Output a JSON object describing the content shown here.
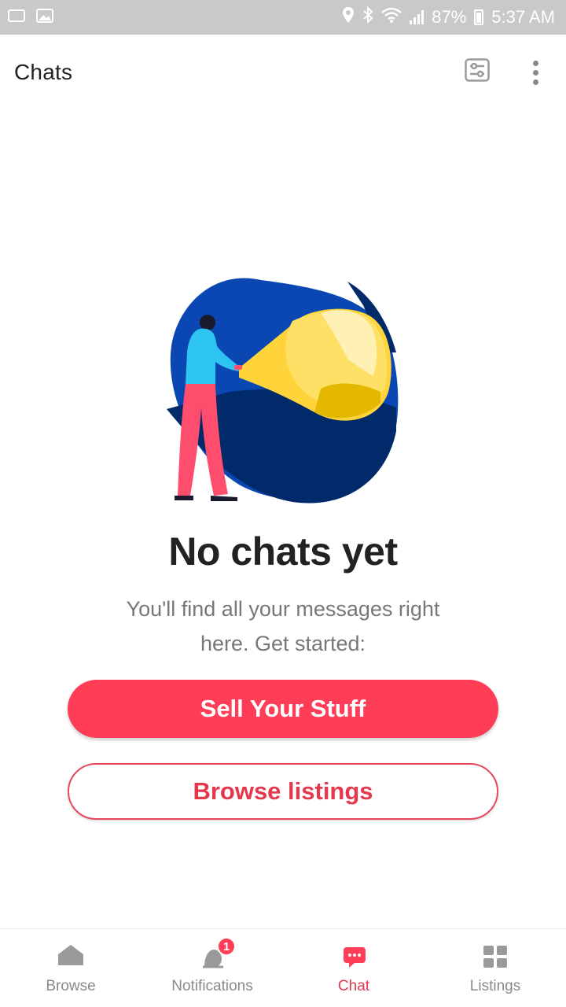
{
  "status_bar": {
    "battery": "87%",
    "time": "5:37 AM",
    "icons": [
      "notification-icon",
      "image-icon",
      "location-icon",
      "bluetooth-icon",
      "wifi-icon",
      "signal-icon",
      "battery-icon"
    ]
  },
  "header": {
    "title": "Chats",
    "actions": [
      "filter-icon",
      "more-vert-icon"
    ]
  },
  "empty_state": {
    "illustration": "person-with-flashlight-illustration",
    "title": "No chats yet",
    "subtitle": "You'll find all your messages right here. Get started:",
    "primary_button": "Sell Your Stuff",
    "secondary_button": "Browse listings"
  },
  "bottom_nav": {
    "items": [
      {
        "label": "Browse",
        "icon": "home-icon",
        "active": false
      },
      {
        "label": "Notifications",
        "icon": "notifications-icon",
        "active": false,
        "badge": "1"
      },
      {
        "label": "Chat",
        "icon": "chat-icon",
        "active": true
      },
      {
        "label": "Listings",
        "icon": "listings-icon",
        "active": false
      }
    ]
  },
  "colors": {
    "accent": "#ff3d57",
    "accent_text": "#e5384f",
    "status_bar": "#c9c9c9",
    "illustration_blue": "#0b47b3",
    "illustration_navy": "#012a6b",
    "illustration_yellow": "#ffd43b"
  }
}
